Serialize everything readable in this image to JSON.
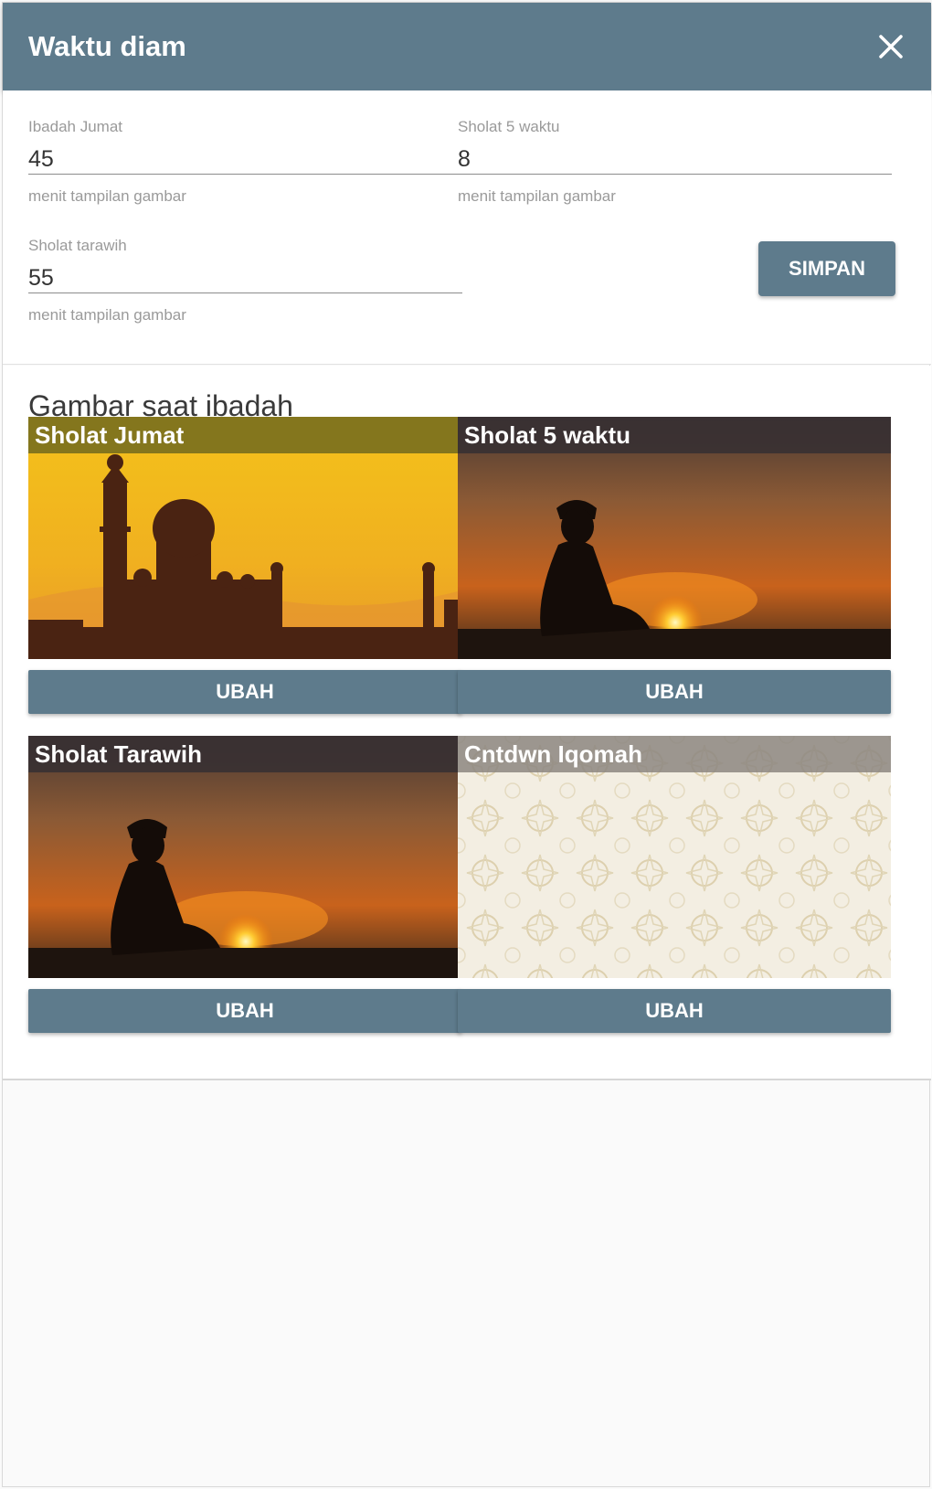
{
  "header": {
    "title": "Waktu diam"
  },
  "fields": {
    "jumat": {
      "label": "Ibadah Jumat",
      "value": "45",
      "hint": "menit tampilan gambar"
    },
    "lima_waktu": {
      "label": "Sholat 5 waktu",
      "value": "8",
      "hint": "menit tampilan gambar"
    },
    "tarawih": {
      "label": "Sholat tarawih",
      "value": "55",
      "hint": "menit tampilan gambar"
    }
  },
  "save_label": "SIMPAN",
  "gallery": {
    "heading": "Gambar saat ibadah",
    "cards": [
      {
        "caption": "Sholat Jumat",
        "button": "UBAH",
        "image": "mosque-silhouette-image"
      },
      {
        "caption": "Sholat 5 waktu",
        "button": "UBAH",
        "image": "praying-man-sunset-image"
      },
      {
        "caption": "Sholat Tarawih",
        "button": "UBAH",
        "image": "praying-man-sunset-image"
      },
      {
        "caption": "Cntdwn Iqomah",
        "button": "UBAH",
        "image": "islamic-pattern-image"
      }
    ]
  },
  "colors": {
    "header": "#5e7b8c",
    "button": "#5e7b8c"
  }
}
